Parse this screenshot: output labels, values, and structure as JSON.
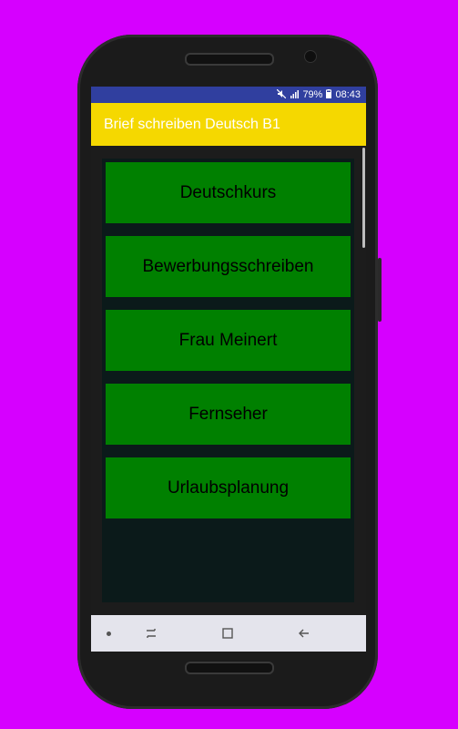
{
  "status_bar": {
    "mute_icon": "mute-icon",
    "signal_icon": "signal-icon",
    "battery_percent": "79%",
    "battery_icon": "battery-icon",
    "time": "08:43"
  },
  "app_bar": {
    "title": "Brief schreiben Deutsch B1"
  },
  "topics": [
    {
      "label": "Deutschkurs"
    },
    {
      "label": "Bewerbungsschreiben"
    },
    {
      "label": "Frau Meinert"
    },
    {
      "label": "Fernseher"
    },
    {
      "label": "Urlaubsplanung"
    }
  ],
  "nav_bar": {
    "dot_icon": "nav-dot-icon",
    "recents_icon": "recents-icon",
    "home_icon": "home-icon",
    "back_icon": "back-icon"
  },
  "colors": {
    "background": "#d600ff",
    "status_bar": "#303f9f",
    "app_bar": "#f5d800",
    "topic_button": "#008000",
    "nav_bar": "#e4e4ec"
  }
}
